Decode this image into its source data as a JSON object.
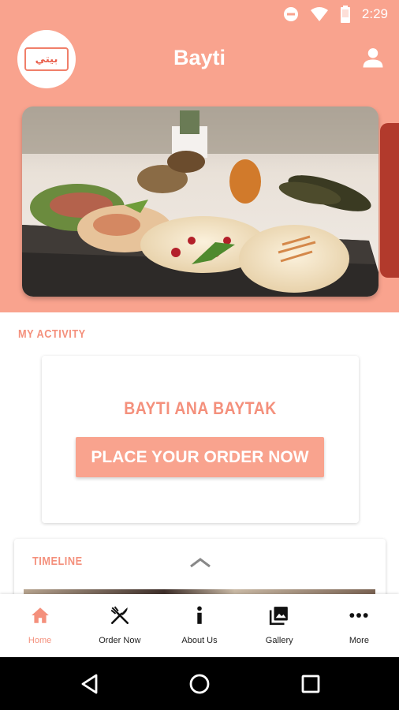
{
  "status_bar": {
    "time": "2:29",
    "icons": [
      "do-not-disturb-icon",
      "wifi-icon",
      "battery-icon"
    ]
  },
  "header": {
    "logo_text": "بيتي",
    "title": "Bayti",
    "profile_icon": "person-icon"
  },
  "hero": {
    "image": "mezze-platter-photo"
  },
  "activity": {
    "section_title": "MY ACTIVITY",
    "card_heading": "BAYTI ANA BAYTAK",
    "button_label": "PLACE YOUR ORDER NOW"
  },
  "timeline": {
    "title": "TIMELINE",
    "toggle_icon": "chevron-up-icon"
  },
  "bottom_nav": {
    "items": [
      {
        "label": "Home",
        "icon": "home-icon",
        "active": true
      },
      {
        "label": "Order Now",
        "icon": "fork-knife-icon",
        "active": false
      },
      {
        "label": "About Us",
        "icon": "info-icon",
        "active": false
      },
      {
        "label": "Gallery",
        "icon": "gallery-icon",
        "active": false
      },
      {
        "label": "More",
        "icon": "more-dots-icon",
        "active": false
      }
    ]
  },
  "system_nav": [
    "back-icon",
    "home-circle-icon",
    "recents-icon"
  ],
  "colors": {
    "primary": "#f9a38e",
    "accent_text": "#f4907c",
    "white": "#ffffff"
  }
}
